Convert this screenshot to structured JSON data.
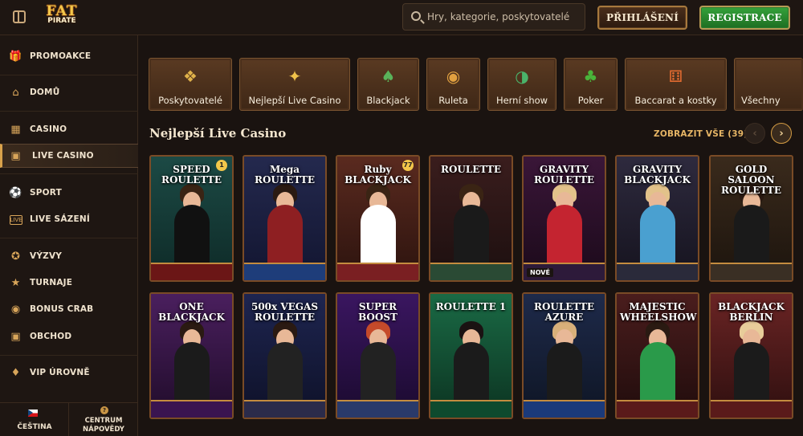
{
  "header": {
    "logo_line1": "FAT",
    "logo_line2": "PIRATE",
    "search_placeholder": "Hry, kategorie, poskytovatelé",
    "login_label": "PŘIHLÁŠENÍ",
    "register_label": "REGISTRACE"
  },
  "sidebar": {
    "items": [
      {
        "label": "PROMOAKCE",
        "icon": "gift-icon",
        "active": false
      },
      {
        "label": "DOMŮ",
        "icon": "home-icon",
        "active": false
      },
      {
        "label": "CASINO",
        "icon": "casino-icon",
        "active": false
      },
      {
        "label": "LIVE CASINO",
        "icon": "live-casino-icon",
        "active": true
      },
      {
        "label": "SPORT",
        "icon": "football-icon",
        "active": false
      },
      {
        "label": "LIVE SÁZENÍ",
        "icon": "live-betting-icon",
        "active": false
      },
      {
        "label": "VÝZVY",
        "icon": "medal-icon",
        "active": false
      },
      {
        "label": "TURNAJE",
        "icon": "trophy-icon",
        "active": false
      },
      {
        "label": "BONUS CRAB",
        "icon": "crab-icon",
        "active": false
      },
      {
        "label": "OBCHOD",
        "icon": "shop-icon",
        "active": false
      },
      {
        "label": "VIP ÚROVNĚ",
        "icon": "diamond-icon",
        "active": false
      }
    ],
    "language_label": "ČEŠTINA",
    "help_label_1": "CENTRUM",
    "help_label_2": "NÁPOVĚDY"
  },
  "categories": [
    {
      "label": "Poskytovatelé",
      "icon": "scroll-icon"
    },
    {
      "label": "Nejlepší Live Casino",
      "icon": "torch-icon"
    },
    {
      "label": "Blackjack",
      "icon": "cards-icon"
    },
    {
      "label": "Ruleta",
      "icon": "roulette-icon"
    },
    {
      "label": "Herní show",
      "icon": "wheel-icon"
    },
    {
      "label": "Poker",
      "icon": "poker-icon"
    },
    {
      "label": "Baccarat a kostky",
      "icon": "dice-icon"
    },
    {
      "label": "Všechny",
      "icon": "all-icon"
    }
  ],
  "section": {
    "title": "Nejlepší Live Casino",
    "show_all": "ZOBRAZIT VŠE (39)"
  },
  "games": [
    {
      "title": "SPEED ROULETTE",
      "colors": [
        "#1c4a45",
        "#0e2a27"
      ],
      "outfit": "#111111",
      "hair": "#3a2414",
      "table": "#6b1616",
      "chip": "1",
      "badge": ""
    },
    {
      "title": "Mega ROULETTE",
      "colors": [
        "#24294e",
        "#121530"
      ],
      "outfit": "#8e1f22",
      "hair": "#2a1a12",
      "table": "#1e3d7a",
      "chip": "",
      "badge": ""
    },
    {
      "title": "Ruby BLACKJACK",
      "colors": [
        "#5a2a1f",
        "#2c130e"
      ],
      "outfit": "#ffffff",
      "hair": "#3a2414",
      "table": "#7a1f22",
      "chip": "77",
      "badge": ""
    },
    {
      "title": "ROULETTE",
      "colors": [
        "#3a1d1d",
        "#1c0f0f"
      ],
      "outfit": "#1a1a1a",
      "hair": "#3a2414",
      "table": "#2a4a34",
      "chip": "",
      "badge": ""
    },
    {
      "title": "GRAVITY ROULETTE",
      "colors": [
        "#3a1638",
        "#1b0a1a"
      ],
      "outfit": "#c42430",
      "hair": "#e2c28a",
      "table": "#2d1a3a",
      "chip": "",
      "badge": "NOVÉ"
    },
    {
      "title": "GRAVITY BLACKJACK",
      "colors": [
        "#2e2a3e",
        "#15131e"
      ],
      "outfit": "#4aa0d0",
      "hair": "#e2c28a",
      "table": "#2a2a3a",
      "chip": "",
      "badge": ""
    },
    {
      "title": "GOLD SALOON ROULETTE",
      "colors": [
        "#3a2a1c",
        "#1c140d"
      ],
      "outfit": "#1a1a1a",
      "hair": "#2a1a12",
      "table": "#3a2f24",
      "chip": "",
      "badge": ""
    },
    {
      "title": "ONE BLACKJACK",
      "colors": [
        "#4a1f5e",
        "#200c2a"
      ],
      "outfit": "#1b1b1b",
      "hair": "#2a1a12",
      "table": "#3a1450",
      "chip": "",
      "badge": ""
    },
    {
      "title": "500x VEGAS ROULETTE",
      "colors": [
        "#1e2550",
        "#0e1128"
      ],
      "outfit": "#222222",
      "hair": "#2a1a12",
      "table": "#2b2b4a",
      "chip": "",
      "badge": ""
    },
    {
      "title": "SUPER BOOST",
      "colors": [
        "#3a1660",
        "#1a0a2e"
      ],
      "outfit": "#222222",
      "hair": "#c54a2a",
      "table": "#2a3a6a",
      "chip": "",
      "badge": ""
    },
    {
      "title": "ROULETTE 1",
      "colors": [
        "#1a6a45",
        "#0c3321"
      ],
      "outfit": "#1b1b1b",
      "hair": "#1a1212",
      "table": "#0e4a2e",
      "chip": "",
      "badge": ""
    },
    {
      "title": "ROULETTE AZURE",
      "colors": [
        "#1e2a4a",
        "#0e1524"
      ],
      "outfit": "#1b1b1b",
      "hair": "#d8b07a",
      "table": "#1b3a7a",
      "chip": "",
      "badge": ""
    },
    {
      "title": "MAJESTIC WHEELSHOW",
      "colors": [
        "#4a1d1d",
        "#200c0c"
      ],
      "outfit": "#2a9a4a",
      "hair": "#2a1a12",
      "table": "#5a1a1a",
      "chip": "",
      "badge": ""
    },
    {
      "title": "BLACKJACK BERLIN",
      "colors": [
        "#6a2424",
        "#2e0f0f"
      ],
      "outfit": "#1b1b1b",
      "hair": "#e8cd9a",
      "table": "#5a1a1a",
      "chip": "",
      "badge": ""
    }
  ]
}
